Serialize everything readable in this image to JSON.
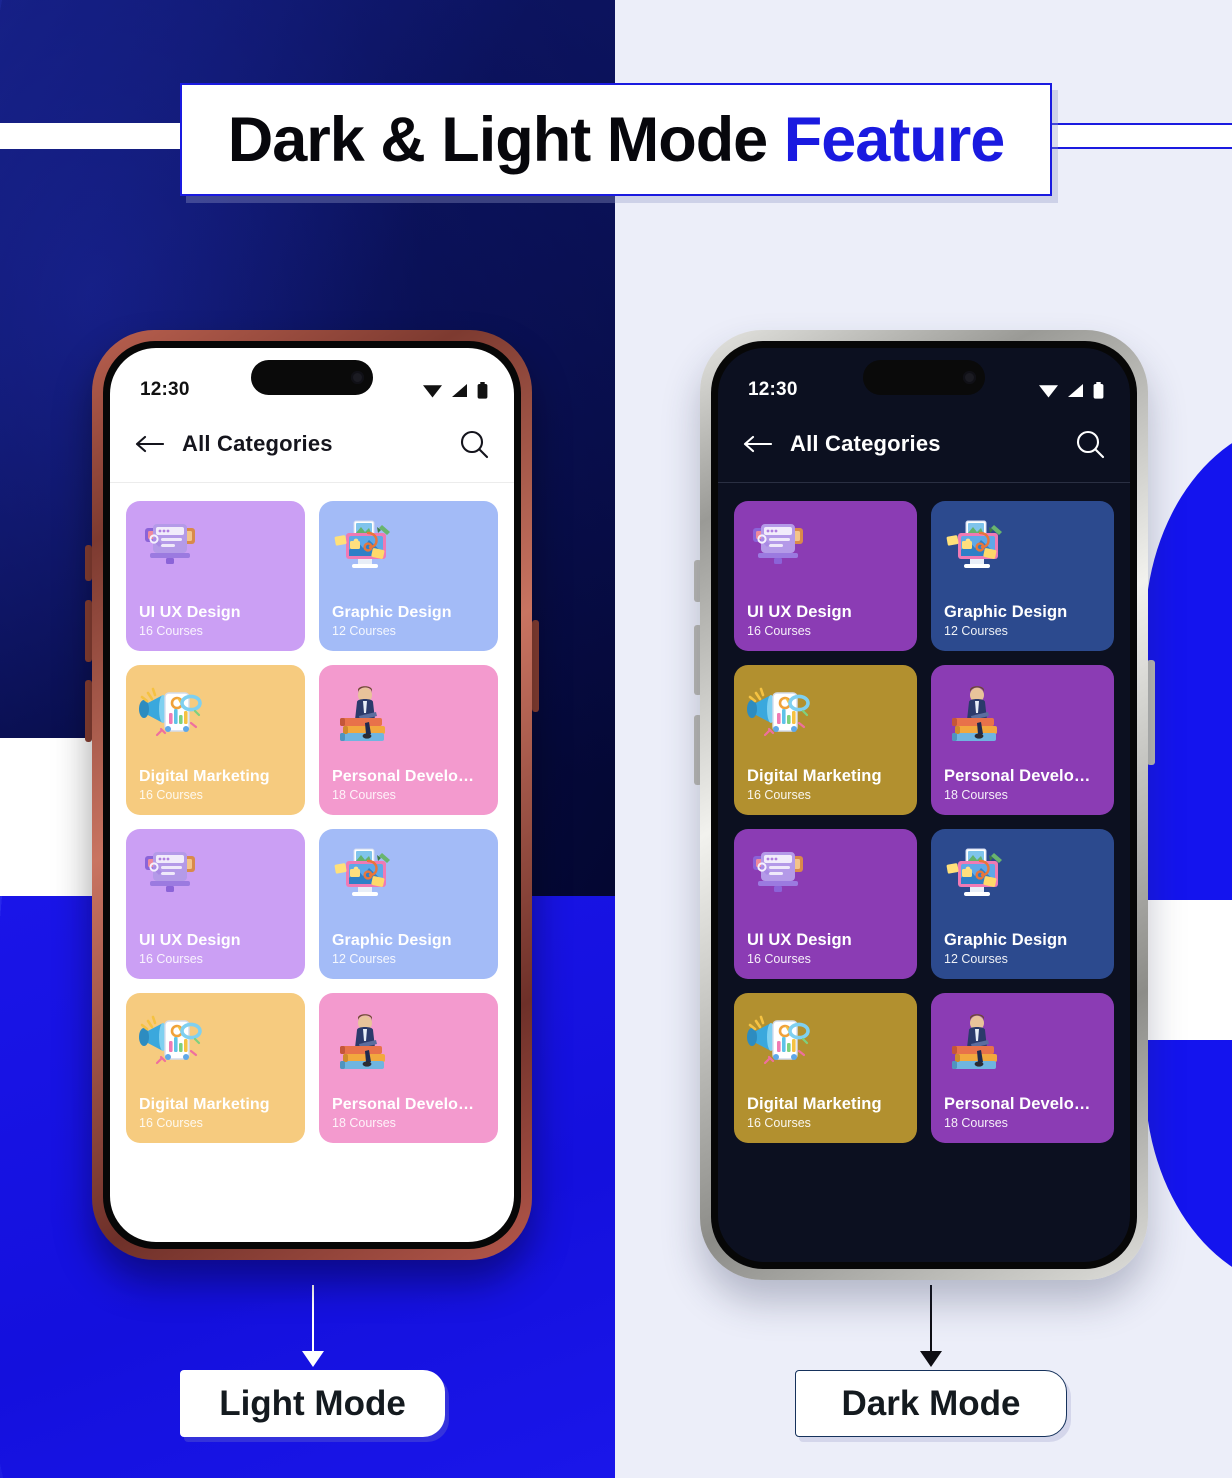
{
  "banner": {
    "title_main": "Dark & Light Mode ",
    "title_accent": "Feature",
    "accent_color": "#1a1ae0"
  },
  "phones": [
    {
      "variant": "light",
      "frame_color": "#a9523f",
      "screen_bg": "#ffffff",
      "status": {
        "time": "12:30",
        "wifi_icon": "wifi-icon",
        "signal_icon": "signal-icon",
        "battery_icon": "battery-icon"
      },
      "appbar": {
        "back_icon": "back-arrow-icon",
        "title": "All Categories",
        "search_icon": "search-icon"
      },
      "cards": [
        {
          "name": "UI UX Design",
          "count": "16 Courses",
          "color": "#ccа0f5",
          "bg": "#cb9ff4",
          "icon": "ui-ux-design-icon"
        },
        {
          "name": "Graphic Design",
          "count": "12 Courses",
          "bg": "#a3bbf7",
          "icon": "graphic-design-icon"
        },
        {
          "name": "Digital Marketing",
          "count": "16 Courses",
          "bg": "#f6cb7f",
          "icon": "digital-marketing-icon"
        },
        {
          "name": "Personal Develo…",
          "count": "18 Courses",
          "bg": "#f39ace",
          "icon": "personal-development-icon"
        },
        {
          "name": "UI UX Design",
          "count": "16 Courses",
          "bg": "#cb9ff4",
          "icon": "ui-ux-design-icon"
        },
        {
          "name": "Graphic Design",
          "count": "12 Courses",
          "bg": "#a3bbf7",
          "icon": "graphic-design-icon"
        },
        {
          "name": "Digital Marketing",
          "count": "16 Courses",
          "bg": "#f6cb7f",
          "icon": "digital-marketing-icon"
        },
        {
          "name": "Personal Develo…",
          "count": "18 Courses",
          "bg": "#f39ace",
          "icon": "personal-development-icon"
        }
      ],
      "mode_label": "Light Mode"
    },
    {
      "variant": "dark",
      "frame_color": "#cdcdc8",
      "screen_bg": "#0c1020",
      "status": {
        "time": "12:30",
        "wifi_icon": "wifi-icon",
        "signal_icon": "signal-icon",
        "battery_icon": "battery-icon"
      },
      "appbar": {
        "back_icon": "back-arrow-icon",
        "title": "All Categories",
        "search_icon": "search-icon"
      },
      "cards": [
        {
          "name": "UI UX Design",
          "count": "16 Courses",
          "bg": "#8b3cb4",
          "icon": "ui-ux-design-icon"
        },
        {
          "name": "Graphic Design",
          "count": "12 Courses",
          "bg": "#2c4a8e",
          "icon": "graphic-design-icon"
        },
        {
          "name": "Digital Marketing",
          "count": "16 Courses",
          "bg": "#b2902f",
          "icon": "digital-marketing-icon"
        },
        {
          "name": "Personal Develo…",
          "count": "18 Courses",
          "bg": "#8b3cb4",
          "icon": "personal-development-icon"
        },
        {
          "name": "UI UX Design",
          "count": "16 Courses",
          "bg": "#8b3cb4",
          "icon": "ui-ux-design-icon"
        },
        {
          "name": "Graphic Design",
          "count": "12 Courses",
          "bg": "#2c4a8e",
          "icon": "graphic-design-icon"
        },
        {
          "name": "Digital Marketing",
          "count": "16 Courses",
          "bg": "#b2902f",
          "icon": "digital-marketing-icon"
        },
        {
          "name": "Personal Develo…",
          "count": "18 Courses",
          "bg": "#8b3cb4",
          "icon": "personal-development-icon"
        }
      ],
      "mode_label": "Dark Mode"
    }
  ],
  "background": {
    "left_color": "#070c46",
    "right_color": "#eceef9",
    "accent_blue": "#1414ee"
  }
}
